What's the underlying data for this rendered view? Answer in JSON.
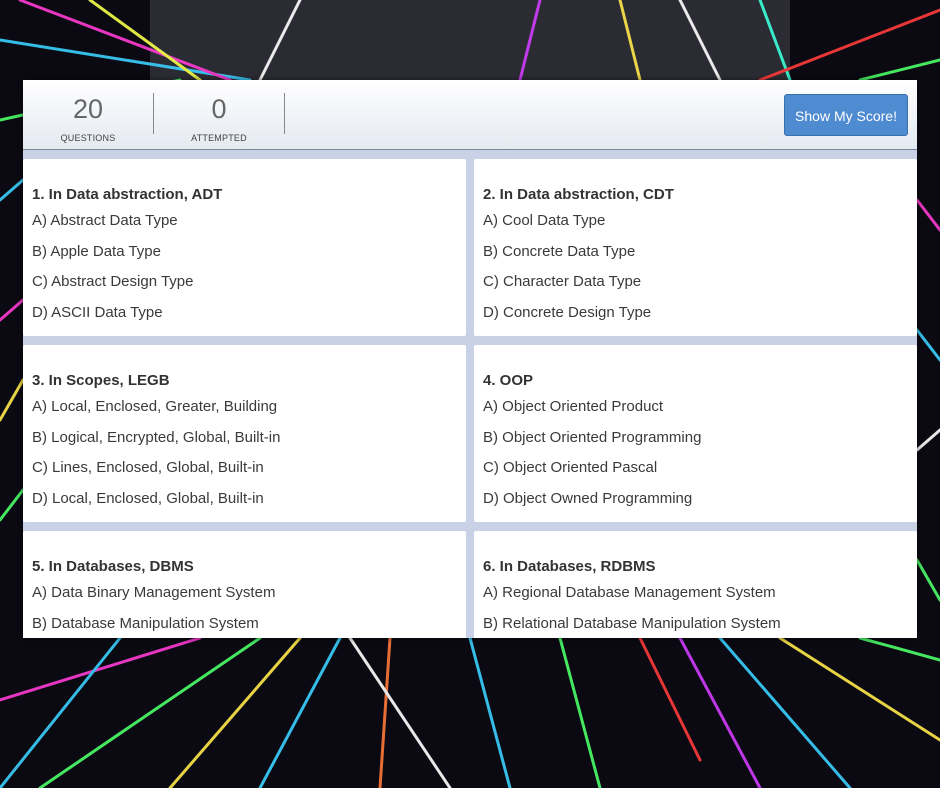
{
  "stats": {
    "questions_count": "20",
    "questions_label": "QUESTIONS",
    "attempted_count": "0",
    "attempted_label": "ATTEMPTED"
  },
  "score_button_label": "Show My Score!",
  "questions": [
    {
      "title": "1. In Data abstraction, ADT",
      "options": [
        "A) Abstract Data Type",
        "B) Apple Data Type",
        "C) Abstract Design Type",
        "D) ASCII Data Type"
      ]
    },
    {
      "title": "2. In Data abstraction, CDT",
      "options": [
        "A) Cool Data Type",
        "B) Concrete Data Type",
        "C) Character Data Type",
        "D) Concrete Design Type"
      ]
    },
    {
      "title": "3. In Scopes, LEGB",
      "options": [
        "A) Local, Enclosed, Greater, Building",
        "B) Logical, Encrypted, Global, Built-in",
        "C) Lines, Enclosed, Global, Built-in",
        "D) Local, Enclosed, Global, Built-in"
      ]
    },
    {
      "title": "4. OOP",
      "options": [
        "A) Object Oriented Product",
        "B) Object Oriented Programming",
        "C) Object Oriented Pascal",
        "D) Object Owned Programming"
      ]
    },
    {
      "title": "5. In Databases, DBMS",
      "options": [
        "A) Data Binary Management System",
        "B) Database Manipulation System"
      ]
    },
    {
      "title": "6. In Databases, RDBMS",
      "options": [
        "A) Regional Database Management System",
        "B) Relational Database Manipulation System"
      ]
    }
  ]
}
